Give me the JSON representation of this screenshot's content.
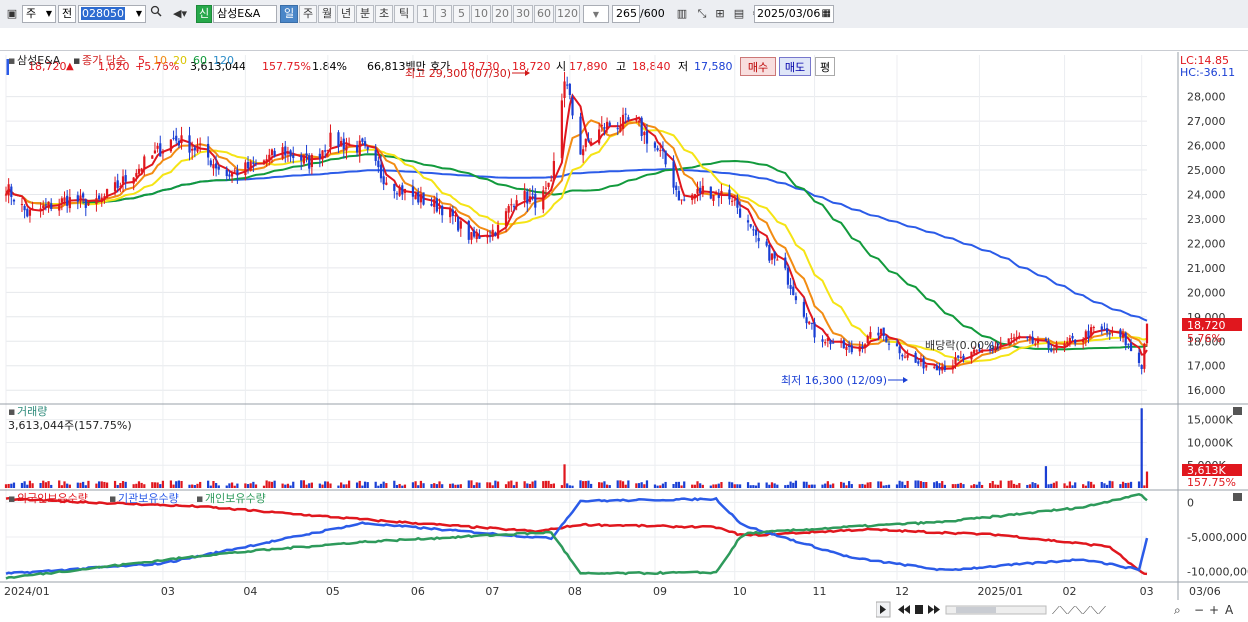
{
  "toolbar": {
    "market": "주",
    "prev_label": "전",
    "code": "028050",
    "name": "삼성E&A",
    "new_badge": "신",
    "periods": [
      "일",
      "주",
      "월",
      "년",
      "분",
      "초",
      "틱"
    ],
    "selected_period": "일",
    "intervals": [
      "1",
      "3",
      "5",
      "10",
      "20",
      "30",
      "60",
      "120"
    ],
    "count": "265",
    "count_total": "/600",
    "date": "2025/03/06"
  },
  "quote": {
    "price": "18,720",
    "change": "1,020",
    "change_rate": "+5.76%",
    "volume": "3,613,044",
    "volume_ratio": "157.75%",
    "turnover_ratio": "1.84%",
    "amount": "66,813백만",
    "bid_label": "호가",
    "bid1": "18,730",
    "bid2": "18,720",
    "open_label": "시",
    "open": "17,890",
    "high_label": "고",
    "high": "18,840",
    "low_label": "저",
    "low": "17,580",
    "buy_label": "매수",
    "sell_label": "매도",
    "avg_label": "평"
  },
  "colors": {
    "up": "#e0171e",
    "down": "#1a3fd4",
    "ma5": "#e0171e",
    "ma10": "#f28c13",
    "ma20": "#f5e415",
    "ma60": "#129a3c",
    "ma120": "#2b5be8",
    "foreign": "#e0171e",
    "institution": "#2b5be8",
    "individual": "#2e9a5b"
  },
  "chart_data": [
    {
      "type": "candlestick",
      "title": "삼성E&A",
      "legend": {
        "label": "종가 단순",
        "periods": [
          "5",
          "10",
          "20",
          "60",
          "120"
        ]
      },
      "x_ticks": [
        "2024/01",
        "03",
        "04",
        "05",
        "06",
        "07",
        "08",
        "09",
        "10",
        "11",
        "12",
        "2025/01",
        "02",
        "03"
      ],
      "x_end_label": "03/06",
      "y_ticks": [
        16000,
        17000,
        18000,
        19000,
        20000,
        21000,
        22000,
        23000,
        24000,
        25000,
        26000,
        27000,
        28000
      ],
      "ylim": [
        15600,
        29700
      ],
      "lc_label": "LC:14.85",
      "hc_label": "HC:-36.11",
      "last_price_label": "18,720",
      "last_change_label": "5.76%",
      "annotations": {
        "high": "최고 29,300 (07/30)",
        "low": "최저 16,300 (12/09)",
        "dividend": "배당락(0.00%)"
      },
      "close_anchors": [
        [
          "2024/01/02",
          24300
        ],
        [
          "2024/01/10",
          23200
        ],
        [
          "2024/01/25",
          23800
        ],
        [
          "2024/02/05",
          23600
        ],
        [
          "2024/02/20",
          25000
        ],
        [
          "2024/03/05",
          26300
        ],
        [
          "2024/03/15",
          25800
        ],
        [
          "2024/03/25",
          24800
        ],
        [
          "2024/04/05",
          25200
        ],
        [
          "2024/04/15",
          25800
        ],
        [
          "2024/04/25",
          25300
        ],
        [
          "2024/05/03",
          26200
        ],
        [
          "2024/05/15",
          25900
        ],
        [
          "2024/05/22",
          24800
        ],
        [
          "2024/06/01",
          24000
        ],
        [
          "2024/06/15",
          23400
        ],
        [
          "2024/06/25",
          22200
        ],
        [
          "2024/07/05",
          22600
        ],
        [
          "2024/07/12",
          24000
        ],
        [
          "2024/07/20",
          23700
        ],
        [
          "2024/07/25",
          24300
        ],
        [
          "2024/07/30",
          28800
        ],
        [
          "2024/08/05",
          25800
        ],
        [
          "2024/08/14",
          26800
        ],
        [
          "2024/08/25",
          27000
        ],
        [
          "2024/09/05",
          25500
        ],
        [
          "2024/09/12",
          23700
        ],
        [
          "2024/09/20",
          24200
        ],
        [
          "2024/10/01",
          23900
        ],
        [
          "2024/10/10",
          22100
        ],
        [
          "2024/10/20",
          21000
        ],
        [
          "2024/11/01",
          18300
        ],
        [
          "2024/11/15",
          17600
        ],
        [
          "2024/11/25",
          18400
        ],
        [
          "2024/12/09",
          17100
        ],
        [
          "2024/12/20",
          17000
        ],
        [
          "2025/01/01",
          17500
        ],
        [
          "2025/01/15",
          18100
        ],
        [
          "2025/02/01",
          17700
        ],
        [
          "2025/02/15",
          18500
        ],
        [
          "2025/02/25",
          18100
        ],
        [
          "2025/03/04",
          17000
        ],
        [
          "2025/03/06",
          18720
        ]
      ]
    },
    {
      "type": "bar",
      "title": "거래량",
      "value_label": "3,613,044주(157.75%)",
      "y_ticks": [
        5000000,
        10000000,
        15000000
      ],
      "y_tick_labels": [
        "5,000K",
        "10,000K",
        "15,000K"
      ],
      "ylim": [
        0,
        18000000
      ],
      "last_value_label": "3,613K",
      "last_ratio_label": "157.75%",
      "spikes": [
        [
          "2025/03/04",
          17500000
        ],
        [
          "2025/03/06",
          3613044
        ],
        [
          "2024/07/30",
          5200000
        ],
        [
          "2025/01/27",
          4800000
        ]
      ]
    },
    {
      "type": "line",
      "series_names": [
        "외국인보유수량",
        "기관보유수량",
        "개인보유수량"
      ],
      "y_ticks": [
        0,
        -5000000,
        -10000000
      ],
      "y_tick_labels": [
        "0",
        "-5,000,000",
        "-10,000,000"
      ],
      "ylim": [
        -11200000,
        1500000
      ],
      "series": [
        {
          "name": "외국인보유수량",
          "anchors": [
            [
              "2024/01/02",
              500000
            ],
            [
              "2024/03/15",
              -600000
            ],
            [
              "2024/05/20",
              -2600000
            ],
            [
              "2024/07/20",
              -4200000
            ],
            [
              "2024/08/05",
              -3200000
            ],
            [
              "2024/09/25",
              -3600000
            ],
            [
              "2024/10/05",
              -4800000
            ],
            [
              "2024/11/20",
              -3900000
            ],
            [
              "2025/01/10",
              -4700000
            ],
            [
              "2025/02/20",
              -6400000
            ],
            [
              "2025/03/03",
              -9900000
            ],
            [
              "2025/03/06",
              -10400000
            ]
          ]
        },
        {
          "name": "기관보유수량",
          "anchors": [
            [
              "2024/01/02",
              -10300000
            ],
            [
              "2024/03/01",
              -8800000
            ],
            [
              "2024/05/15",
              -3000000
            ],
            [
              "2024/07/25",
              -5200000
            ],
            [
              "2024/08/05",
              200000
            ],
            [
              "2024/09/25",
              500000
            ],
            [
              "2024/10/05",
              -3300000
            ],
            [
              "2024/11/15",
              -8000000
            ],
            [
              "2024/12/20",
              -9800000
            ],
            [
              "2025/02/10",
              -8200000
            ],
            [
              "2025/03/03",
              -9700000
            ],
            [
              "2025/03/06",
              -5200000
            ]
          ]
        },
        {
          "name": "개인보유수량",
          "anchors": [
            [
              "2024/01/02",
              -10900000
            ],
            [
              "2024/03/20",
              -7500000
            ],
            [
              "2024/05/15",
              -5700000
            ],
            [
              "2024/07/25",
              -4300000
            ],
            [
              "2024/08/05",
              -10300000
            ],
            [
              "2024/09/25",
              -10100000
            ],
            [
              "2024/10/05",
              -4500000
            ],
            [
              "2024/11/15",
              -3500000
            ],
            [
              "2024/12/20",
              -2800000
            ],
            [
              "2025/02/10",
              -700000
            ],
            [
              "2025/03/03",
              1200000
            ],
            [
              "2025/03/06",
              300000
            ]
          ]
        }
      ]
    }
  ]
}
